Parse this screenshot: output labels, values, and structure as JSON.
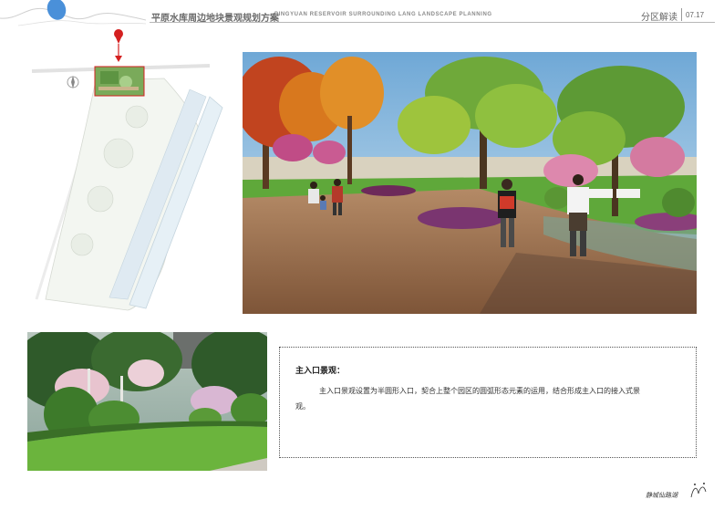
{
  "header": {
    "title_cn": "平原水库周边地块景观规划方案",
    "title_en": "PINGYUAN RESERVOIR SURROUNDING LANG LANDSCAPE PLANNING",
    "section_label": "分区解读",
    "page_number": "07.17"
  },
  "description": {
    "heading": "主入口景观：",
    "body": "主入口景观设置为半圆形入口，契合上整个园区的圆弧形态元素的运用，结合形成主入口的接入式景观。"
  },
  "signature": {
    "text": "静城仙路湖"
  },
  "colors": {
    "logo_blue": "#4a90d9",
    "marker_red": "#d42020",
    "grass_green": "#5fa83a",
    "paving_brown": "#9a6a48"
  }
}
